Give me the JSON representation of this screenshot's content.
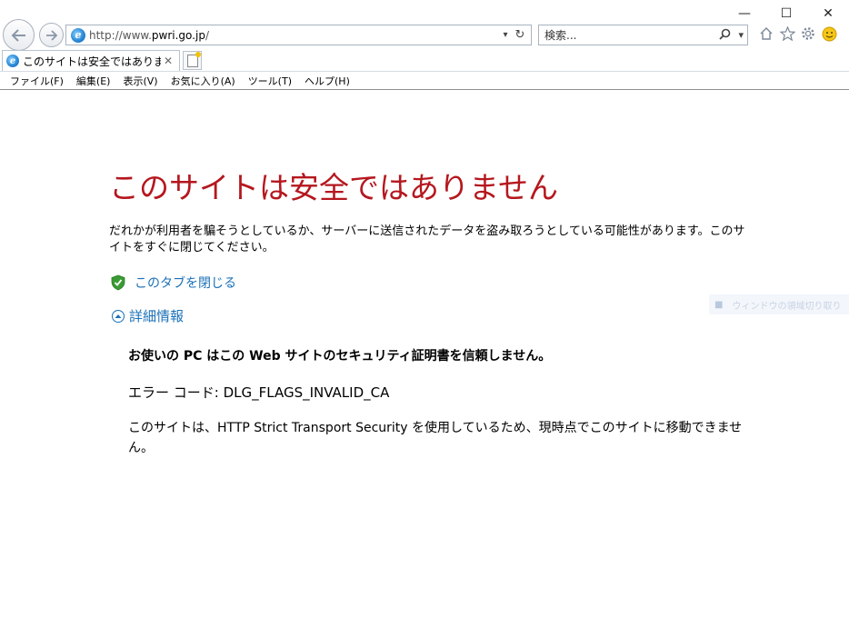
{
  "window": {
    "minimize_glyph": "—",
    "maximize_glyph": "☐",
    "close_glyph": "✕"
  },
  "address_bar": {
    "url_prefix": "http://www.",
    "url_domain": "pwri.go.jp",
    "url_suffix": "/",
    "dropdown_glyph": "▾",
    "refresh_glyph": "↻"
  },
  "search": {
    "placeholder": "検索...",
    "search_glyph": "⚲",
    "dropdown_glyph": "▾"
  },
  "toolbar_icons": [
    "home-icon",
    "favorites-star-icon",
    "gear-icon",
    "smiley-feedback-icon"
  ],
  "tab": {
    "label": "このサイトは安全ではありません",
    "close_glyph": "✕"
  },
  "menu": {
    "items": [
      "ファイル(F)",
      "編集(E)",
      "表示(V)",
      "お気に入り(A)",
      "ツール(T)",
      "ヘルプ(H)"
    ]
  },
  "content": {
    "title": "このサイトは安全ではありません",
    "warning": "だれかが利用者を騙そうとしているか、サーバーに送信されたデータを盗み取ろうとしている可能性があります。このサイトをすぐに閉じてください。",
    "close_tab_link": "このタブを閉じる",
    "details_link": "詳細情報",
    "details_heading": "お使いの PC はこの Web サイトのセキュリティ証明書を信頼しません。",
    "error_code": "エラー コード: DLG_FLAGS_INVALID_CA",
    "hsts_message": "このサイトは、HTTP Strict Transport Security を使用しているため、現時点でこのサイトに移動できません。"
  },
  "overlay": {
    "text": "ウィンドウの領域切り取り"
  },
  "colors": {
    "title_red": "#b5171e",
    "link_blue": "#1a70b8",
    "shield_green": "#3a9b35"
  }
}
